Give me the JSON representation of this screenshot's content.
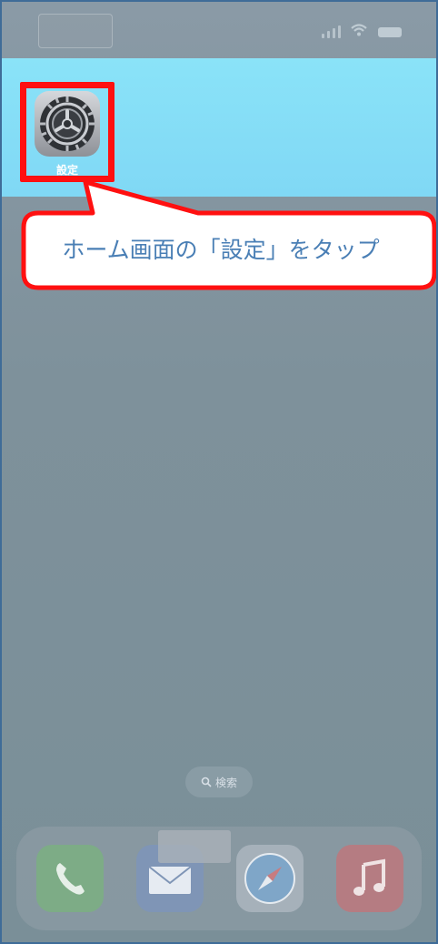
{
  "status_bar": {
    "time": ""
  },
  "home_screen": {
    "app": {
      "label": "設定",
      "icon": "gear-icon"
    }
  },
  "callout": {
    "text": "ホーム画面の「設定」をタップ"
  },
  "search": {
    "label": "検索",
    "icon": "search-icon"
  },
  "dock": {
    "apps": [
      {
        "icon": "phone-icon"
      },
      {
        "icon": "mail-icon"
      },
      {
        "icon": "safari-icon"
      },
      {
        "icon": "music-icon"
      }
    ]
  },
  "colors": {
    "highlight": "#ff1010",
    "callout_text": "#4a7fb5",
    "band": "#8ae3f8"
  }
}
